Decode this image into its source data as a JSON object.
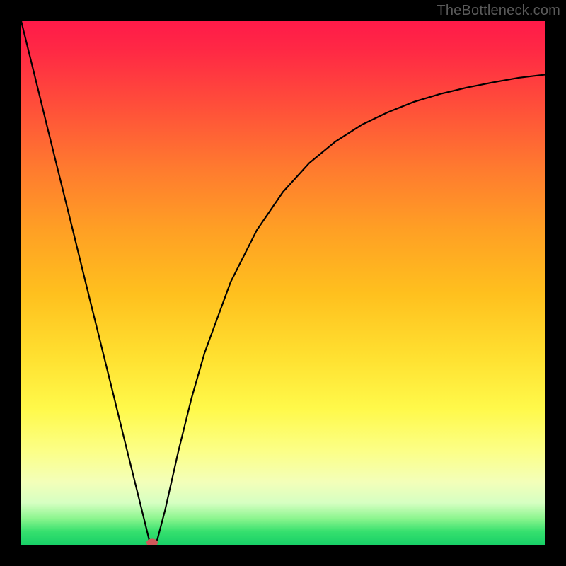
{
  "attribution": "TheBottleneck.com",
  "chart_data": {
    "type": "line",
    "title": "",
    "xlabel": "",
    "ylabel": "",
    "xlim": [
      0,
      1
    ],
    "ylim": [
      0,
      1
    ],
    "x": [
      0.0,
      0.025,
      0.05,
      0.075,
      0.1,
      0.125,
      0.15,
      0.175,
      0.2,
      0.225,
      0.245,
      0.25,
      0.26,
      0.275,
      0.3,
      0.325,
      0.35,
      0.4,
      0.45,
      0.5,
      0.55,
      0.6,
      0.65,
      0.7,
      0.75,
      0.8,
      0.85,
      0.9,
      0.95,
      1.0
    ],
    "values": [
      1.0,
      0.899,
      0.797,
      0.696,
      0.595,
      0.493,
      0.392,
      0.291,
      0.189,
      0.088,
      0.007,
      0.0,
      0.01,
      0.067,
      0.178,
      0.279,
      0.366,
      0.502,
      0.601,
      0.674,
      0.729,
      0.77,
      0.802,
      0.826,
      0.846,
      0.861,
      0.873,
      0.883,
      0.892,
      0.898
    ],
    "marker": {
      "x": 0.25,
      "y": 0.0,
      "color": "#d0585a"
    },
    "background_gradient": {
      "top": "#ff1a49",
      "bottom": "#18d067"
    }
  }
}
